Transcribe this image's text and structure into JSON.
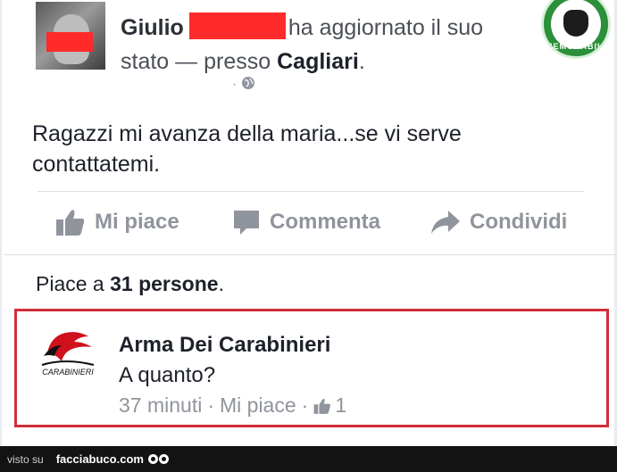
{
  "post": {
    "author_first_name": "Giulio",
    "action_text": "ha aggiornato il suo",
    "action_text_2": "stato",
    "dash": "—",
    "location_prefix": "presso",
    "location": "Cagliari",
    "location_suffix": ".",
    "meta": "·",
    "body": "Ragazzi mi avanza della maria...se vi serve contattatemi."
  },
  "badge": {
    "text": "MEMORABILI",
    "icon": "bearded-face-logo"
  },
  "actions": [
    {
      "label": "Mi piace",
      "icon": "thumbs-up-icon"
    },
    {
      "label": "Commenta",
      "icon": "comment-icon"
    },
    {
      "label": "Condividi",
      "icon": "share-icon"
    }
  ],
  "likes": {
    "prefix": "Piace a",
    "count_text": "31 persone",
    "suffix": "."
  },
  "comment": {
    "author": "Arma Dei Carabinieri",
    "logo_text": "CARABINIERI",
    "text": "A quanto?",
    "time": "37 minuti",
    "sep1": "·",
    "like_label": "Mi piace",
    "sep2": "·",
    "like_count": "1"
  },
  "footer": {
    "visto": "visto su",
    "site": "facciabuco.com"
  },
  "colors": {
    "highlight_border": "#d12d3b",
    "redaction": "#ff2a2a",
    "action_grey": "#90949c"
  }
}
